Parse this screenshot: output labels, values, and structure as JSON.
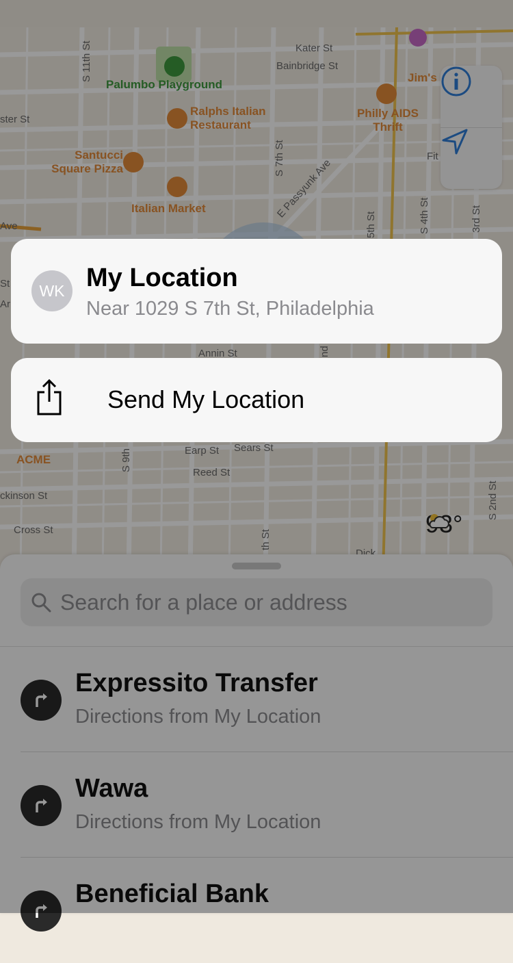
{
  "map": {
    "pois": [
      {
        "name": "Palumbo Playground",
        "color": "green"
      },
      {
        "name": "Ralphs Italian Restaurant",
        "color": "orange"
      },
      {
        "name": "Santucci Square Pizza",
        "color": "orange"
      },
      {
        "name": "Italian Market",
        "color": "orange"
      },
      {
        "name": "Philly AIDS Thrift",
        "color": "orange"
      },
      {
        "name": "Jim's",
        "color": "orange"
      },
      {
        "name": "ACME",
        "color": "orange"
      }
    ],
    "streets": [
      "Kater St",
      "Bainbridge St",
      "S 11th St",
      "ster St",
      "S 7th St",
      "E Passyunk Ave",
      "5th St",
      "S 4th St",
      "3rd St",
      "Ave",
      "St",
      "Ar",
      "Annin St",
      "nd",
      "Earp St",
      "Sears St",
      "S 9th",
      "Reed St",
      "ckinson St",
      "Cross St",
      "th St",
      "Dick",
      "S 2nd St",
      "Fit"
    ],
    "weather": {
      "icon": "partly-sunny-icon",
      "temperature": "93°"
    }
  },
  "popup": {
    "avatar_initials": "WK",
    "title": "My Location",
    "subtitle": "Near 1029 S 7th St, Philadelphia",
    "send_label": "Send My Location"
  },
  "search": {
    "placeholder": "Search for a place or address",
    "value": ""
  },
  "suggestions": [
    {
      "name": "Expressito Transfer",
      "subtitle": "Directions from My Location"
    },
    {
      "name": "Wawa",
      "subtitle": "Directions from My Location"
    },
    {
      "name": "Beneficial Bank",
      "subtitle": ""
    }
  ],
  "colors": {
    "accent": "#2f7ed8",
    "poi_orange": "#e38a3a",
    "park_green": "#3f9a3f"
  }
}
